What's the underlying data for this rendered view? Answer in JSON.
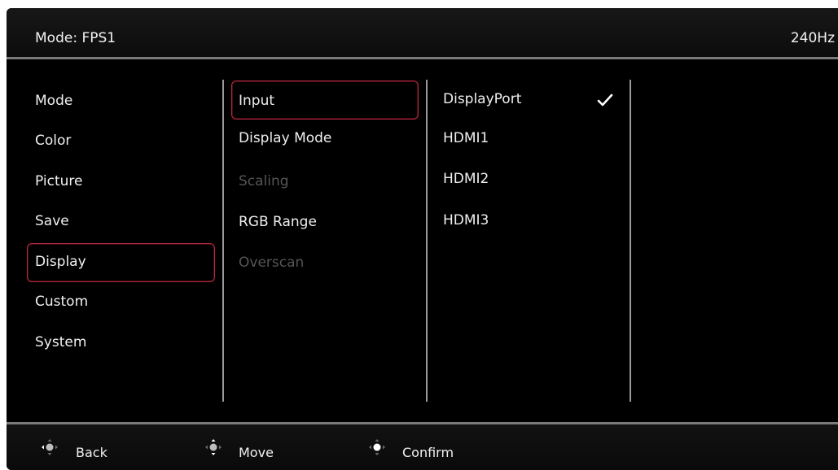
{
  "header": {
    "title": "Mode: FPS1",
    "refresh_rate": "240Hz"
  },
  "main_menu": {
    "items": [
      {
        "label": "Mode"
      },
      {
        "label": "Color"
      },
      {
        "label": "Picture"
      },
      {
        "label": "Save"
      },
      {
        "label": "Display",
        "selected": true
      },
      {
        "label": "Custom"
      },
      {
        "label": "System"
      }
    ]
  },
  "display_menu": {
    "items": [
      {
        "label": "Input",
        "selected": true,
        "enabled": true
      },
      {
        "label": "Display Mode",
        "enabled": true
      },
      {
        "label": "Scaling",
        "enabled": false
      },
      {
        "label": "RGB Range",
        "enabled": true
      },
      {
        "label": "Overscan",
        "enabled": false
      }
    ]
  },
  "input_options": {
    "items": [
      {
        "label": "DisplayPort",
        "checked": true,
        "icon": "checkmark-icon"
      },
      {
        "label": "HDMI1",
        "checked": false
      },
      {
        "label": "HDMI2",
        "checked": false
      },
      {
        "label": "HDMI3",
        "checked": false
      }
    ]
  },
  "footer": {
    "hints": [
      {
        "label": "Back",
        "icon": "joystick-left-icon"
      },
      {
        "label": "Move",
        "icon": "joystick-updown-icon"
      },
      {
        "label": "Confirm",
        "icon": "joystick-press-icon"
      }
    ]
  },
  "colors": {
    "background": "#000000",
    "highlight_border": "#b3283d",
    "text": "#f0f0f0",
    "disabled_text": "#555555",
    "divider": "#9a9a9a"
  }
}
